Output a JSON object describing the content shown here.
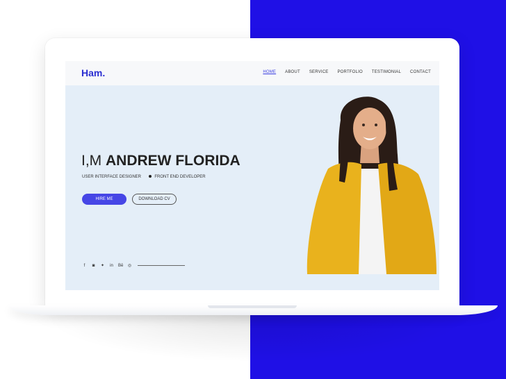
{
  "site": {
    "logo": "Ham.",
    "nav": [
      {
        "label": "HOME",
        "active": true
      },
      {
        "label": "ABOUT",
        "active": false
      },
      {
        "label": "SERVICE",
        "active": false
      },
      {
        "label": "PORTFOLIO",
        "active": false
      },
      {
        "label": "TESTIMONIAL",
        "active": false
      },
      {
        "label": "CONTACT",
        "active": false
      }
    ]
  },
  "hero": {
    "headline_prefix": "I,M",
    "headline_name": "ANDREW FLORIDA",
    "role_1": "USER INTERFACE DESIGNER",
    "role_2": "FRONT END DEVELOPER",
    "primary_button": "HIRE ME",
    "secondary_button": "DOWNLOAD CV"
  },
  "social": [
    {
      "icon": "facebook-icon",
      "glyph": "f"
    },
    {
      "icon": "instagram-icon",
      "glyph": "◙"
    },
    {
      "icon": "twitter-icon",
      "glyph": "✦"
    },
    {
      "icon": "linkedin-icon",
      "glyph": "in"
    },
    {
      "icon": "behance-icon",
      "glyph": "Bē"
    },
    {
      "icon": "dribbble-icon",
      "glyph": "◎"
    }
  ],
  "colors": {
    "accent": "#1f10e6",
    "brand": "#2b2fd1",
    "button": "#4646e6",
    "hero_bg": "#e4eef8"
  }
}
